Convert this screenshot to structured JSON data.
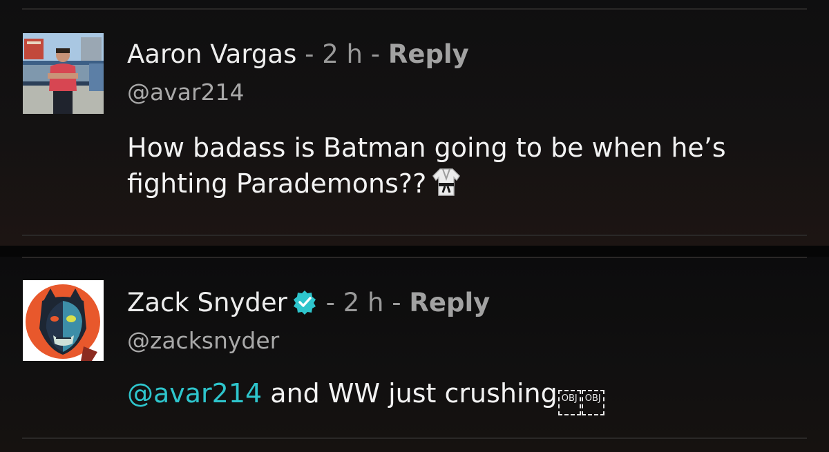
{
  "comments": [
    {
      "name": "Aaron Vargas",
      "separator_1": " - ",
      "time": "2 h",
      "separator_2": " - ",
      "reply_label": "Reply",
      "handle": "@avar214",
      "body": "How badass is Batman going to be when he’s fighting Parademons??",
      "emoji": "martial-arts-uniform-icon",
      "verified": false
    },
    {
      "name": "Zack Snyder",
      "separator_1": " - ",
      "time": "2 h",
      "separator_2": " - ",
      "reply_label": "Reply",
      "handle": "@zacksnyder",
      "mention": "@avar214",
      "body": " and WW just crushing",
      "replacement_glyphs": [
        "OBJ",
        "OBJ"
      ],
      "verified": true
    }
  ],
  "colors": {
    "background": "#0c0c0c",
    "name": "#ededed",
    "meta": "#9a9a9a",
    "mention": "#2ec5cc",
    "verified_badge": "#2ec5cc",
    "divider": "#2a2827"
  }
}
